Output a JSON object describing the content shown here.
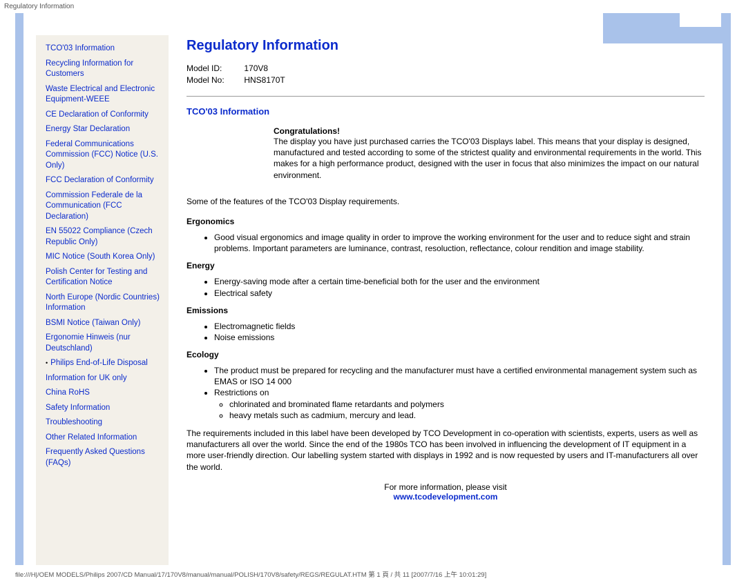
{
  "header": {
    "title": "Regulatory Information"
  },
  "sidebar": {
    "items": [
      {
        "label": "TCO'03 Information",
        "bulleted": false
      },
      {
        "label": "Recycling Information for Customers",
        "bulleted": false
      },
      {
        "label": "Waste Electrical and Electronic Equipment-WEEE",
        "bulleted": false
      },
      {
        "label": "CE Declaration of Conformity",
        "bulleted": false
      },
      {
        "label": "Energy Star Declaration",
        "bulleted": false
      },
      {
        "label": "Federal Communications Commission (FCC) Notice (U.S. Only)",
        "bulleted": false
      },
      {
        "label": "FCC Declaration of Conformity",
        "bulleted": false
      },
      {
        "label": "Commission Federale de la Communication (FCC Declaration)",
        "bulleted": false
      },
      {
        "label": "EN 55022 Compliance (Czech Republic Only)",
        "bulleted": false
      },
      {
        "label": "MIC Notice (South Korea Only)",
        "bulleted": false
      },
      {
        "label": "Polish Center for Testing and Certification Notice",
        "bulleted": false
      },
      {
        "label": "North Europe (Nordic Countries) Information",
        "bulleted": false
      },
      {
        "label": "BSMI Notice (Taiwan Only)",
        "bulleted": false
      },
      {
        "label": "Ergonomie Hinweis (nur Deutschland)",
        "bulleted": false
      },
      {
        "label": "Philips End-of-Life Disposal",
        "bulleted": true
      },
      {
        "label": "Information for UK only",
        "bulleted": false
      },
      {
        "label": "China RoHS",
        "bulleted": false
      },
      {
        "label": "Safety Information",
        "bulleted": false
      },
      {
        "label": "Troubleshooting",
        "bulleted": false
      },
      {
        "label": "Other Related Information",
        "bulleted": false
      },
      {
        "label": "Frequently Asked Questions (FAQs)",
        "bulleted": false
      }
    ]
  },
  "main": {
    "title": "Regulatory Information",
    "model_id_label": "Model ID:",
    "model_id_value": "170V8",
    "model_no_label": "Model No:",
    "model_no_value": "HNS8170T",
    "section_heading": "TCO'03 Information",
    "congrats_title": "Congratulations!",
    "congrats_body": "The display you have just purchased carries the TCO'03 Displays label. This means that your display is designed, manufactured and tested according to some of the strictest quality and environmental requirements in the world. This makes for a high performance product, designed with the user in focus that also minimizes the impact on our natural environment.",
    "features_intro": "Some of the features of the TCO'03 Display requirements.",
    "ergonomics_head": "Ergonomics",
    "ergonomics_items": [
      "Good visual ergonomics and image quality in order to improve the working environment for the user and to reduce sight and strain problems. Important parameters are luminance, contrast, resoluction, reflectance, colour rendition and image stability."
    ],
    "energy_head": "Energy",
    "energy_items": [
      "Energy-saving mode after a certain time-beneficial both for the user and the environment",
      "Electrical safety"
    ],
    "emissions_head": "Emissions",
    "emissions_items": [
      "Electromagnetic fields",
      "Noise emissions"
    ],
    "ecology_head": "Ecology",
    "ecology_items": [
      "The product must be prepared for recycling and the manufacturer must have a certified environmental management system such as EMAS or ISO 14 000",
      "Restrictions on"
    ],
    "ecology_sub_items": [
      "chlorinated and brominated flame retardants and polymers",
      "heavy metals such as cadmium, mercury and lead."
    ],
    "requirements_para": "The requirements included in this label have been developed by TCO Development in co-operation with scientists, experts, users as well as manufacturers all over the world. Since the end of the 1980s TCO has been involved in influencing the development of IT equipment in a more user-friendly direction. Our labelling system started with displays in 1992 and is now requested by users and IT-manufacturers all over the world.",
    "more_info_text": "For more information, please visit",
    "more_info_link": "www.tcodevelopment.com"
  },
  "footer": {
    "path": "file:///H|/OEM MODELS/Philips 2007/CD Manual/17/170V8/manual/manual/POLISH/170V8/safety/REGS/REGULAT.HTM 第 1 頁 / 共 11  [2007/7/16 上午 10:01:29]"
  }
}
